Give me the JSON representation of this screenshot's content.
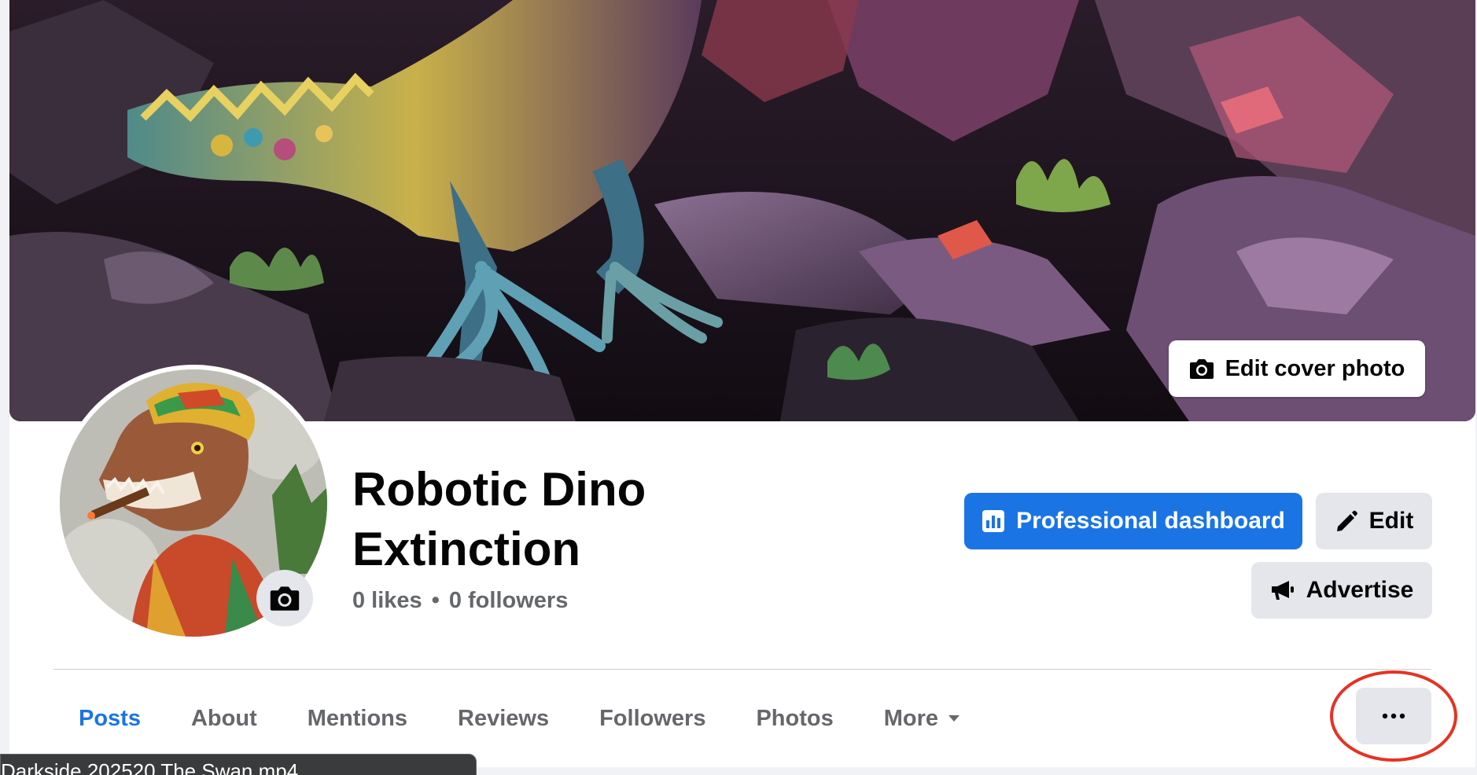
{
  "cover": {
    "edit_label": "Edit cover photo"
  },
  "page": {
    "name": "Robotic Dino Extinction",
    "likes": "0 likes",
    "separator": "•",
    "followers": "0 followers"
  },
  "actions": {
    "professional_dashboard": "Professional dashboard",
    "edit": "Edit",
    "advertise": "Advertise"
  },
  "tabs": [
    {
      "label": "Posts",
      "active": true
    },
    {
      "label": "About"
    },
    {
      "label": "Mentions"
    },
    {
      "label": "Reviews"
    },
    {
      "label": "Followers"
    },
    {
      "label": "Photos"
    },
    {
      "label": "More"
    }
  ],
  "more_menu": {
    "icon": "ellipsis-icon"
  },
  "tooltip": {
    "text": "Darkside 202520 The Swan.mp4"
  },
  "colors": {
    "primary": "#1b74e4",
    "highlight": "#e53323",
    "secondary_button": "#e4e6eb",
    "muted_text": "#65676b"
  }
}
